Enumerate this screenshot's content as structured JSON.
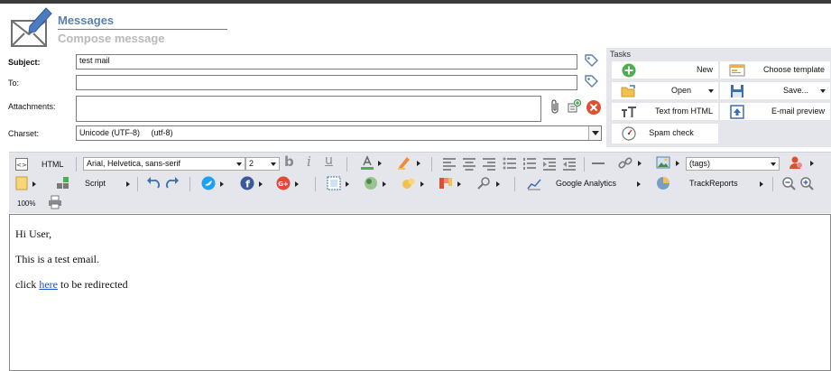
{
  "header": {
    "title": "Messages",
    "subtitle": "Compose message"
  },
  "form": {
    "subject_label": "Subject:",
    "subject_value": "test mail",
    "to_label": "To:",
    "to_value": "",
    "attachments_label": "Attachments:",
    "charset_label": "Charset:",
    "charset_value": "Unicode (UTF-8)     (utf-8)"
  },
  "tasks": {
    "title": "Tasks",
    "items": [
      {
        "label": "New",
        "icon": "plus-circle-icon"
      },
      {
        "label": "Choose template",
        "icon": "template-icon"
      },
      {
        "label": "Open",
        "icon": "open-folder-icon"
      },
      {
        "label": "Save...",
        "icon": "save-icon"
      },
      {
        "label": "Text from HTML",
        "icon": "text-icon"
      },
      {
        "label": "E-mail preview",
        "icon": "preview-icon"
      },
      {
        "label": "Spam check",
        "icon": "spam-check-icon"
      }
    ]
  },
  "toolbar": {
    "html_label": "HTML",
    "font_family": "Arial, Helvetica, sans-serif",
    "font_size": "2",
    "tags_value": "(tags)",
    "script_label": "Script",
    "google_analytics_label": "Google Analytics",
    "trackreports_label": "TrackReports",
    "zoom_label": "100%"
  },
  "editor": {
    "greeting": "Hi User,",
    "body_line": "This is a test email.",
    "link_prefix": "click ",
    "link_text": "here",
    "link_suffix": " to be redirected"
  },
  "colors": {
    "accent": "#5b7fae",
    "panel": "#e4e6ec",
    "link": "#1a4fd6",
    "danger": "#e0502f"
  }
}
